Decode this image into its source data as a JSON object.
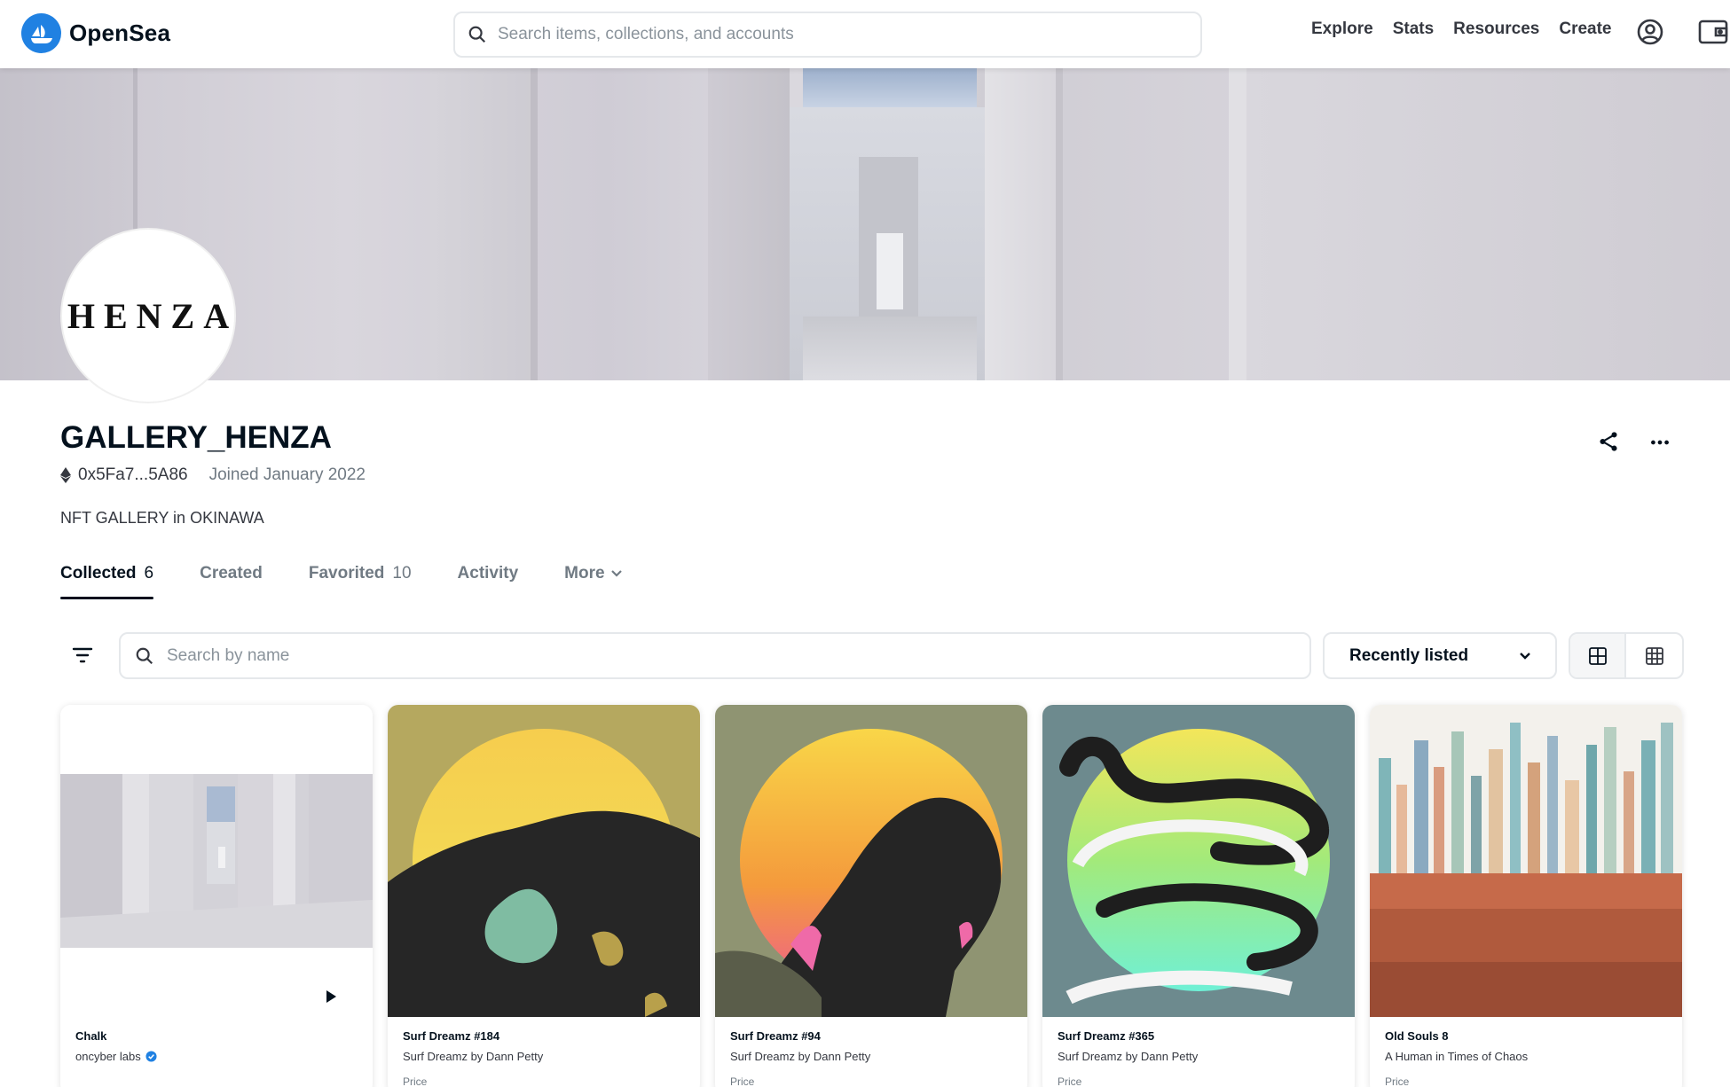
{
  "navbar": {
    "brand": "OpenSea",
    "search_placeholder": "Search items, collections, and accounts",
    "links": [
      "Explore",
      "Stats",
      "Resources",
      "Create"
    ]
  },
  "profile": {
    "avatar_text": "HENZA",
    "name": "GALLERY_HENZA",
    "address": "0x5Fa7...5A86",
    "joined": "Joined January 2022",
    "bio": "NFT GALLERY in OKINAWA"
  },
  "tabs": [
    {
      "label": "Collected",
      "count": "6",
      "active": true
    },
    {
      "label": "Created",
      "count": ""
    },
    {
      "label": "Favorited",
      "count": "10"
    },
    {
      "label": "Activity",
      "count": ""
    },
    {
      "label": "More",
      "count": ""
    }
  ],
  "filters": {
    "search_placeholder": "Search by name",
    "sort_label": "Recently listed"
  },
  "cards": [
    {
      "title": "Chalk",
      "collection": "oncyber labs",
      "verified": true,
      "price_label": ""
    },
    {
      "title": "Surf Dreamz #184",
      "collection": "Surf Dreamz by Dann Petty",
      "price_label": "Price"
    },
    {
      "title": "Surf Dreamz #94",
      "collection": "Surf Dreamz by Dann Petty",
      "price_label": "Price"
    },
    {
      "title": "Surf Dreamz #365",
      "collection": "Surf Dreamz by Dann Petty",
      "price_label": "Price"
    },
    {
      "title": "Old Souls 8",
      "collection": "A Human in Times of Chaos",
      "price_label": "Price"
    }
  ],
  "colors": {
    "brand_blue": "#2081e2",
    "text_primary": "#04111d",
    "text_secondary": "#707a83",
    "border": "#e5e8eb"
  },
  "icons": [
    "search-icon",
    "account-icon",
    "wallet-icon",
    "ethereum-icon",
    "share-icon",
    "ellipsis-icon",
    "chevron-down-icon",
    "filter-icon",
    "grid-large-icon",
    "grid-small-icon",
    "play-icon",
    "verified-badge-icon"
  ]
}
